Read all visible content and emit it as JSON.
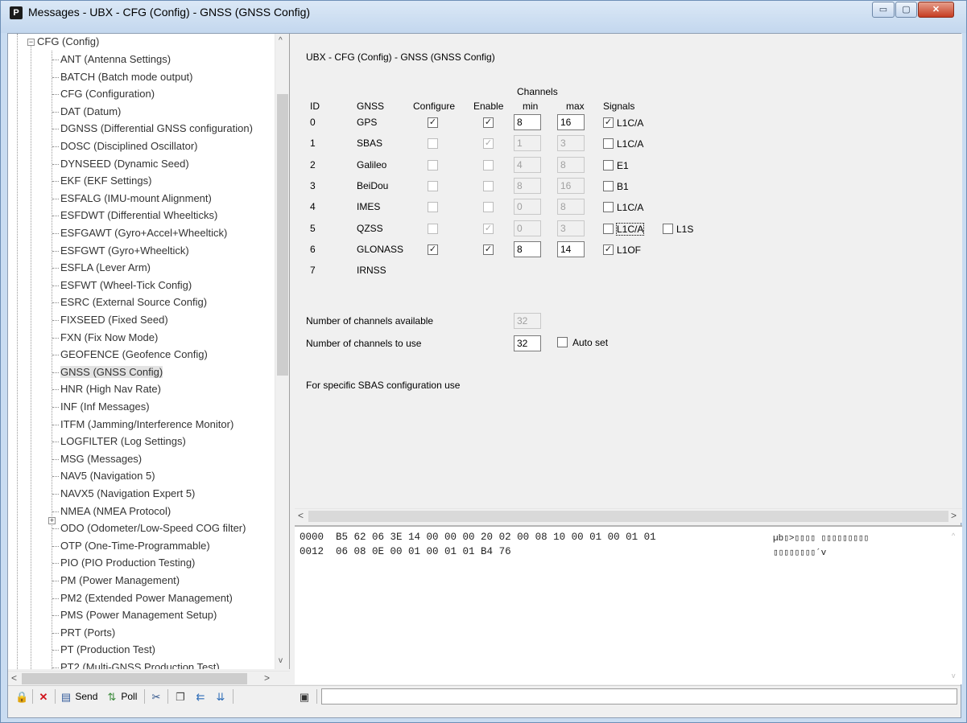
{
  "window": {
    "title": "Messages - UBX - CFG (Config) - GNSS (GNSS Config)",
    "app_icon_letter": "P",
    "controls": {
      "minimize": "▭",
      "maximize": "▢",
      "close": "✕"
    }
  },
  "tree": {
    "root": {
      "expander": "−",
      "label": "CFG (Config)"
    },
    "items": [
      "ANT (Antenna Settings)",
      "BATCH (Batch mode output)",
      "CFG (Configuration)",
      "DAT (Datum)",
      "DGNSS (Differential GNSS configuration)",
      "DOSC (Disciplined Oscillator)",
      "DYNSEED (Dynamic Seed)",
      "EKF (EKF Settings)",
      "ESFALG (IMU-mount Alignment)",
      "ESFDWT (Differential Wheelticks)",
      "ESFGAWT (Gyro+Accel+Wheeltick)",
      "ESFGWT (Gyro+Wheeltick)",
      "ESFLA (Lever Arm)",
      "ESFWT (Wheel-Tick Config)",
      "ESRC (External Source Config)",
      "FIXSEED (Fixed Seed)",
      "FXN (Fix Now Mode)",
      "GEOFENCE (Geofence Config)",
      "GNSS (GNSS Config)",
      "HNR (High Nav Rate)",
      "INF (Inf Messages)",
      "ITFM (Jamming/Interference Monitor)",
      "LOGFILTER (Log Settings)",
      "MSG (Messages)",
      "NAV5 (Navigation 5)",
      "NAVX5 (Navigation Expert 5)",
      "NMEA (NMEA Protocol)",
      "ODO (Odometer/Low-Speed COG filter)",
      "OTP (One-Time-Programmable)",
      "PIO (PIO Production Testing)",
      "PM (Power Management)",
      "PM2 (Extended Power Management)",
      "PMS (Power Management Setup)",
      "PRT (Ports)",
      "PT (Production Test)",
      "PT2 (Multi-GNSS Production Test)"
    ],
    "selected_index": 18,
    "otp_expander": "+",
    "scroll_up": "^",
    "scroll_down": "v",
    "scroll_left": "<",
    "scroll_right": ">"
  },
  "config": {
    "title": "UBX - CFG (Config) - GNSS (GNSS Config)",
    "headers": {
      "channels": "Channels",
      "id": "ID",
      "gnss": "GNSS",
      "configure": "Configure",
      "enable": "Enable",
      "min": "min",
      "max": "max",
      "signals": "Signals"
    },
    "rows": [
      {
        "id": "0",
        "gnss": "GPS",
        "configure": true,
        "enable": true,
        "min": "8",
        "max": "16",
        "signal": "L1C/A",
        "signal_checked": true
      },
      {
        "id": "1",
        "gnss": "SBAS",
        "configure": false,
        "enable": true,
        "min": "1",
        "max": "3",
        "signal": "L1C/A",
        "signal_checked": false
      },
      {
        "id": "2",
        "gnss": "Galileo",
        "configure": false,
        "enable": false,
        "min": "4",
        "max": "8",
        "signal": "E1",
        "signal_checked": false
      },
      {
        "id": "3",
        "gnss": "BeiDou",
        "configure": false,
        "enable": false,
        "min": "8",
        "max": "16",
        "signal": "B1",
        "signal_checked": false
      },
      {
        "id": "4",
        "gnss": "IMES",
        "configure": false,
        "enable": false,
        "min": "0",
        "max": "8",
        "signal": "L1C/A",
        "signal_checked": false
      },
      {
        "id": "5",
        "gnss": "QZSS",
        "configure": false,
        "enable": true,
        "min": "0",
        "max": "3",
        "signal": "L1C/A",
        "signal_checked": false,
        "signal2": "L1S",
        "signal2_checked": false
      },
      {
        "id": "6",
        "gnss": "GLONASS",
        "configure": true,
        "enable": true,
        "min": "8",
        "max": "14",
        "signal": "L1OF",
        "signal_checked": true
      },
      {
        "id": "7",
        "gnss": "IRNSS"
      }
    ],
    "channels_available_label": "Number of channels available",
    "channels_available": "32",
    "channels_to_use_label": "Number of channels to use",
    "channels_to_use": "32",
    "auto_set_label": "Auto set",
    "sbas_note": "For specific SBAS configuration use",
    "scroll_left": "<",
    "scroll_right": ">"
  },
  "hex": {
    "lines": [
      {
        "offset": "0000",
        "bytes": "B5 62 06 3E 14 00 00 00 20 02 00 08 10 00 01 00 01 01",
        "ascii": "µb▯>▯▯▯▯ ▯▯▯▯▯▯▯▯▯"
      },
      {
        "offset": "0012",
        "bytes": "06 08 0E 00 01 00 01 01 B4 76",
        "ascii": "▯▯▯▯▯▯▯▯´v"
      }
    ],
    "scroll_up": "^",
    "scroll_down": "v"
  },
  "toolbar": {
    "send_label": "Send",
    "poll_label": "Poll",
    "status_text": ""
  },
  "colors": {
    "title_bar": "#c9dcf1",
    "close_button": "#c53c22",
    "selection": "#e3e3e3"
  }
}
